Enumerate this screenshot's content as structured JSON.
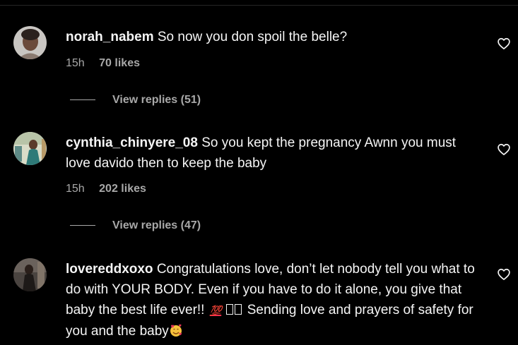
{
  "colors": {
    "background": "#000000",
    "text_primary": "#f5f5f5",
    "text_secondary": "#a8a8a8"
  },
  "comments": [
    {
      "username": "norah_nabem",
      "text": "So now you don spoil the belle?",
      "time": "15h",
      "likes": "70 likes",
      "view_replies": "View replies (51)",
      "like_icon": "heart-outline-icon"
    },
    {
      "username": "cynthia_chinyere_08",
      "text": "So you kept the pregnancy Awnn you must love davido then to keep the baby",
      "time": "15h",
      "likes": "202 likes",
      "view_replies": "View replies (47)",
      "like_icon": "heart-outline-icon"
    },
    {
      "username": "lovereddxoxo",
      "text": "Congratulations love, don’t let nobody tell you what to do with YOUR BODY. Even if you have to do it alone, you give that baby the best life ever!!",
      "emoji_hundred": "💯",
      "text_after": "Sending love and prayers of safety for you and the baby",
      "emoji_end": "smiling-face-with-hearts-icon",
      "like_icon": "heart-outline-icon"
    }
  ]
}
